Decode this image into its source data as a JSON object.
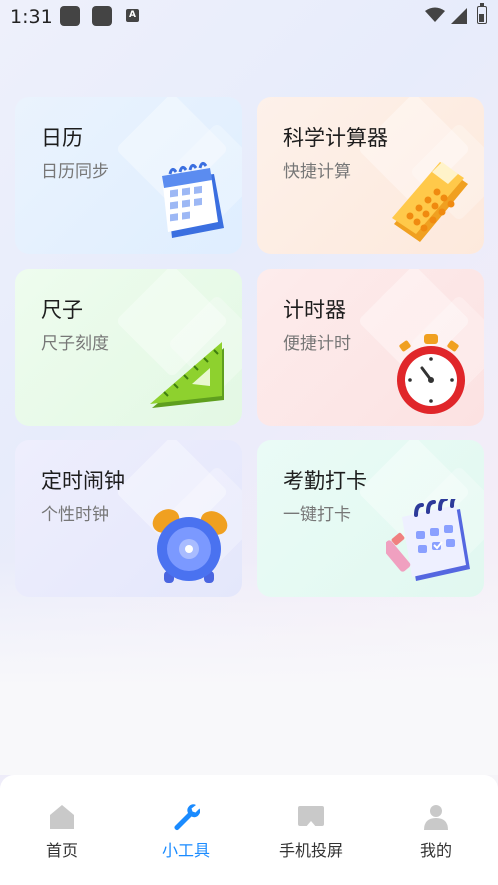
{
  "status_bar": {
    "time": "1:31",
    "notification_badge": "A"
  },
  "tools": [
    {
      "title": "日历",
      "subtitle": "日历同步",
      "icon": "calendar-icon"
    },
    {
      "title": "科学计算器",
      "subtitle": "快捷计算",
      "icon": "calculator-icon"
    },
    {
      "title": "尺子",
      "subtitle": "尺子刻度",
      "icon": "ruler-icon"
    },
    {
      "title": "计时器",
      "subtitle": "便捷计时",
      "icon": "stopwatch-icon"
    },
    {
      "title": "定时闹钟",
      "subtitle": "个性时钟",
      "icon": "alarm-clock-icon"
    },
    {
      "title": "考勤打卡",
      "subtitle": "一键打卡",
      "icon": "checklist-icon"
    }
  ],
  "bottom_nav": {
    "items": [
      {
        "label": "首页",
        "icon": "home-icon",
        "active": false
      },
      {
        "label": "小工具",
        "icon": "wrench-icon",
        "active": true
      },
      {
        "label": "手机投屏",
        "icon": "screen-cast-icon",
        "active": false
      },
      {
        "label": "我的",
        "icon": "user-icon",
        "active": false
      }
    ]
  },
  "colors": {
    "accent": "#1a8bff",
    "inactive_nav": "#c9c9c9"
  }
}
